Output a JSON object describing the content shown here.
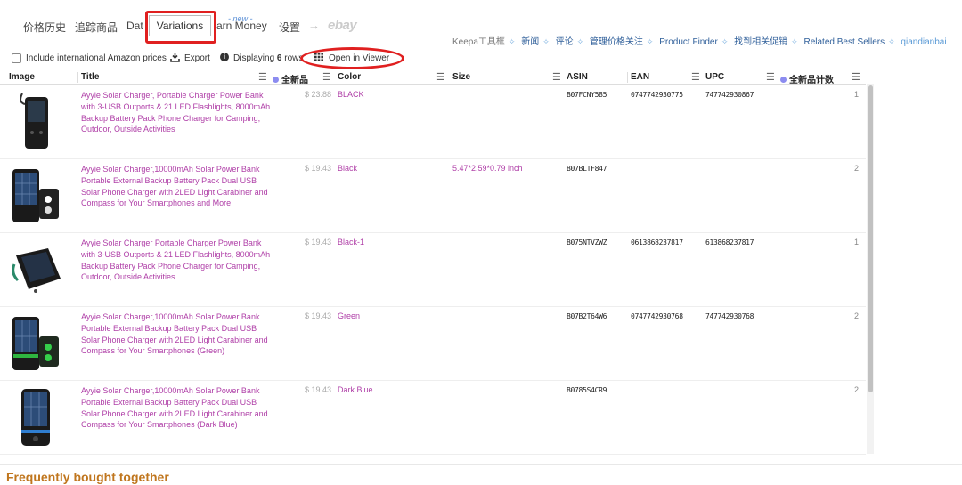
{
  "tabs": [
    {
      "label": "价格历史"
    },
    {
      "label": "追踪商品"
    },
    {
      "label": "Dat"
    },
    {
      "label": "Variations"
    },
    {
      "label": "arn Money"
    },
    {
      "label": "设置"
    }
  ],
  "new_badge": "- new -",
  "ebay_label": "ebay",
  "links": [
    "Keepa工具框",
    "新闻",
    "评论",
    "管理价格关注",
    "Product Finder",
    "找到相关促销",
    "Related Best Sellers",
    "qiandianbai"
  ],
  "toolbar": {
    "intl_label": "Include international Amazon prices",
    "export_label": "Export",
    "displaying_prefix": "Displaying ",
    "displaying_count": "6",
    "displaying_suffix": " rows",
    "viewer_label": "Open in Viewer"
  },
  "table": {
    "headers": {
      "image": "Image",
      "title": "Title",
      "new_price": "全新品",
      "color": "Color",
      "size": "Size",
      "asin": "ASIN",
      "ean": "EAN",
      "upc": "UPC",
      "new_count": "全新品计数"
    },
    "rows": [
      {
        "title": "Ayyie Solar Charger, Portable Charger Power Bank with 3-USB Outports & 21 LED Flashlights, 8000mAh Backup Battery Pack Phone Charger for Camping, Outdoor, Outside Activities",
        "price": "$ 23.88",
        "color": "BLACK",
        "size": "",
        "asin": "B07FCNY585",
        "ean": "0747742930775",
        "upc": "747742930867",
        "count": "1"
      },
      {
        "title": "Ayyie Solar Charger,10000mAh Solar Power Bank Portable External Backup Battery Pack Dual USB Solar Phone Charger with 2LED Light Carabiner and Compass for Your Smartphones and More",
        "price": "$ 19.43",
        "color": "Black",
        "size": "5.47*2.59*0.79 inch",
        "asin": "B07BLTF847",
        "ean": "",
        "upc": "",
        "count": "2"
      },
      {
        "title": "Ayyie Solar Charger Portable Charger Power Bank with 3-USB Outports & 21 LED Flashlights, 8000mAh Backup Battery Pack Phone Charger for Camping, Outdoor, Outside Activities",
        "price": "$ 19.43",
        "color": "Black-1",
        "size": "",
        "asin": "B075NTVZWZ",
        "ean": "0613868237817",
        "upc": "613868237817",
        "count": "1"
      },
      {
        "title": "Ayyie Solar Charger,10000mAh Solar Power Bank Portable External Backup Battery Pack Dual USB Solar Phone Charger with 2LED Light Carabiner and Compass for Your Smartphones (Green)",
        "price": "$ 19.43",
        "color": "Green",
        "size": "",
        "asin": "B07B2T64W6",
        "ean": "0747742930768",
        "upc": "747742930768",
        "count": "2"
      },
      {
        "title": "Ayyie Solar Charger,10000mAh Solar Power Bank Portable External Backup Battery Pack Dual USB Solar Phone Charger with 2LED Light Carabiner and Compass for Your Smartphones (Dark Blue)",
        "price": "$ 19.43",
        "color": "Dark Blue",
        "size": "",
        "asin": "B0785S4CR9",
        "ean": "",
        "upc": "",
        "count": "2"
      }
    ]
  },
  "frequently_bought": "Frequently bought together",
  "colors": {
    "accent_red": "#e02020",
    "title_magenta": "#b040a8",
    "link_blue": "#2f5f9a",
    "fbt_orange": "#c0761e",
    "dot_purple": "#8c8cf0"
  },
  "icons": [
    "checkbox-icon",
    "export-icon",
    "info-icon",
    "grid-icon",
    "column-menu-icon",
    "arrow-right-icon"
  ]
}
